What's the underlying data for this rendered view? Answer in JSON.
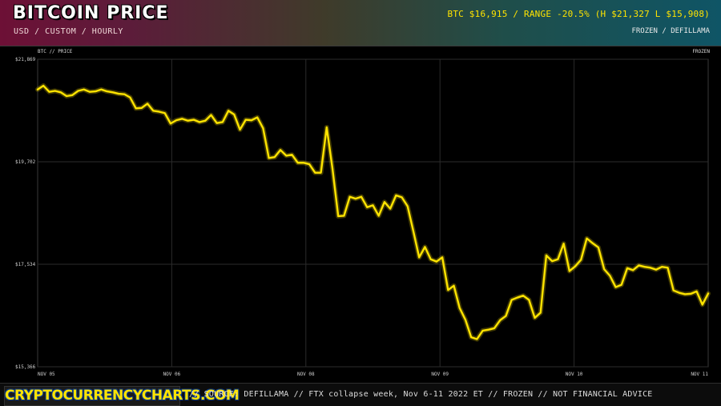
{
  "header": {
    "title": "BITCOIN PRICE",
    "subtitle": "USD / CUSTOM / HOURLY",
    "stats": "BTC $16,915 / RANGE -20.5% (H $21,327 L $15,908)",
    "source": "FROZEN / DEFILLAMA"
  },
  "panel": {
    "left_label": "BTC // PRICE",
    "right_label": "FROZEN"
  },
  "footer": {
    "logo": "CRYPTOCURRENCYCHARTS.COM",
    "note": "// SOURCE: DEFILLAMA // FTX collapse week, Nov 6-11 2022 ET // FROZEN // NOT FINANCIAL ADVICE"
  },
  "colors": {
    "line": "#ffe400",
    "grid": "#2b2b2b",
    "background": "#000000"
  },
  "chart_data": {
    "type": "line",
    "title": "BITCOIN PRICE",
    "ylim": [
      15366,
      21869
    ],
    "y_ticks": [
      {
        "value": 15366,
        "label": "$15,366"
      },
      {
        "value": 17534,
        "label": "$17,534"
      },
      {
        "value": 19702,
        "label": "$19,702"
      },
      {
        "value": 21869,
        "label": "$21,869"
      }
    ],
    "x_ticks": [
      "NOV 05",
      "NOV 06",
      "NOV 08",
      "NOV 09",
      "NOV 10",
      "NOV 11"
    ],
    "grid": true,
    "series": [
      {
        "values": [
          21230,
          21310,
          21180,
          21200,
          21170,
          21090,
          21110,
          21200,
          21230,
          21180,
          21190,
          21230,
          21190,
          21170,
          21140,
          21130,
          21060,
          20830,
          20840,
          20930,
          20780,
          20760,
          20730,
          20510,
          20580,
          20610,
          20570,
          20590,
          20540,
          20570,
          20690,
          20520,
          20540,
          20780,
          20700,
          20380,
          20590,
          20580,
          20640,
          20410,
          19780,
          19800,
          19950,
          19830,
          19850,
          19680,
          19680,
          19650,
          19470,
          19470,
          20430,
          19560,
          18550,
          18560,
          18960,
          18920,
          18960,
          18740,
          18780,
          18560,
          18850,
          18710,
          18990,
          18950,
          18760,
          18230,
          17680,
          17900,
          17640,
          17590,
          17680,
          16990,
          17080,
          16610,
          16360,
          15990,
          15950,
          16130,
          16150,
          16180,
          16350,
          16440,
          16780,
          16830,
          16870,
          16780,
          16400,
          16510,
          17720,
          17600,
          17640,
          17970,
          17390,
          17490,
          17630,
          18080,
          17980,
          17890,
          17430,
          17290,
          17050,
          17100,
          17450,
          17410,
          17510,
          17480,
          17460,
          17420,
          17480,
          17460,
          16980,
          16930,
          16900,
          16910,
          16960,
          16680,
          16915
        ]
      }
    ]
  }
}
